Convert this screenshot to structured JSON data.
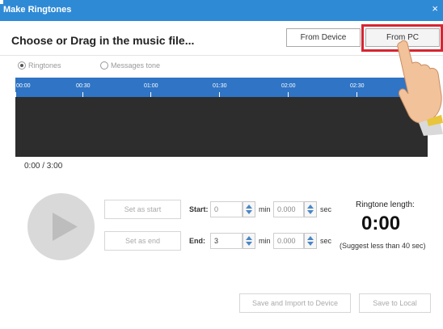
{
  "window": {
    "title": "Make Ringtones",
    "close_glyph": "×"
  },
  "header": {
    "title": "Choose or Drag in the music file..."
  },
  "source_buttons": {
    "device": "From Device",
    "pc": "From PC"
  },
  "mode": {
    "ringtones": "Ringtones",
    "messages": "Messages tone",
    "selected": "Ringtones"
  },
  "timeline": {
    "ticks": [
      "00:00",
      "00:30",
      "01:00",
      "01:30",
      "02:00",
      "02:30"
    ]
  },
  "time_display": "0:00 / 3:00",
  "controls": {
    "set_start": "Set as start",
    "set_end": "Set as end",
    "start_label": "Start:",
    "end_label": "End:",
    "start_min": "0",
    "start_sec": "0.000",
    "end_min": "3",
    "end_sec": "0.000",
    "min_unit": "min",
    "sec_unit": "sec"
  },
  "length": {
    "label": "Ringtone length:",
    "value": "0:00",
    "hint": "(Suggest less than 40 sec)"
  },
  "actions": {
    "import": "Save and Import to Device",
    "local": "Save to Local"
  },
  "colors": {
    "titlebar": "#2f8ad6",
    "ruler": "#2f74c5",
    "highlight": "#d62531",
    "waveform_bg": "#2d2d2d"
  },
  "icons": {
    "play": "play-icon",
    "pointer": "pointing-hand-icon"
  }
}
